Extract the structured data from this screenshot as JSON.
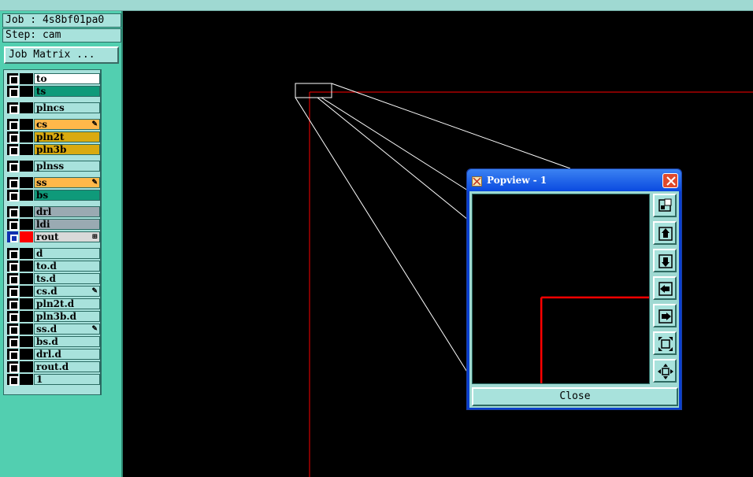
{
  "job": {
    "label": "Job : 4s8bf01pa0",
    "step": "Step: cam"
  },
  "job_matrix_button": "Job Matrix ...",
  "layers": [
    {
      "name": "to",
      "color": "#ffffff",
      "mark": ""
    },
    {
      "name": "ts",
      "color": "#0f9a7a",
      "mark": ""
    },
    {
      "name": "plncs",
      "color": "#a8e2dc",
      "mark": ""
    },
    {
      "name": "cs",
      "color": "#ffb84a",
      "mark": "✎"
    },
    {
      "name": "pln2t",
      "color": "#d9aa10",
      "mark": ""
    },
    {
      "name": "pln3b",
      "color": "#d9aa10",
      "mark": ""
    },
    {
      "name": "plnss",
      "color": "#a8e2dc",
      "mark": ""
    },
    {
      "name": "ss",
      "color": "#ffb84a",
      "mark": "✎"
    },
    {
      "name": "bs",
      "color": "#0f9a7a",
      "mark": ""
    },
    {
      "name": "drl",
      "color": "#9aaab2",
      "mark": ""
    },
    {
      "name": "ldi",
      "color": "#9aaab2",
      "mark": ""
    },
    {
      "name": "rout",
      "color": "#d9d9d9",
      "mark": "⊞"
    },
    {
      "name": "d",
      "color": "#a8e2dc",
      "mark": ""
    },
    {
      "name": "to.d",
      "color": "#a8e2dc",
      "mark": ""
    },
    {
      "name": "ts.d",
      "color": "#a8e2dc",
      "mark": ""
    },
    {
      "name": "cs.d",
      "color": "#a8e2dc",
      "mark": "✎"
    },
    {
      "name": "pln2t.d",
      "color": "#a8e2dc",
      "mark": ""
    },
    {
      "name": "pln3b.d",
      "color": "#a8e2dc",
      "mark": ""
    },
    {
      "name": "ss.d",
      "color": "#a8e2dc",
      "mark": "✎"
    },
    {
      "name": "bs.d",
      "color": "#a8e2dc",
      "mark": ""
    },
    {
      "name": "drl.d",
      "color": "#a8e2dc",
      "mark": ""
    },
    {
      "name": "rout.d",
      "color": "#a8e2dc",
      "mark": ""
    },
    {
      "name": "1",
      "color": "#a8e2dc",
      "mark": ""
    }
  ],
  "popview": {
    "title": "Popview - 1",
    "close_label": "Close",
    "tools": [
      {
        "icon": "zoom-home-icon"
      },
      {
        "icon": "pan-up-icon"
      },
      {
        "icon": "pan-down-icon"
      },
      {
        "icon": "pan-left-icon"
      },
      {
        "icon": "pan-right-icon"
      },
      {
        "icon": "zoom-in-icon"
      },
      {
        "icon": "zoom-out-icon"
      }
    ]
  },
  "colors": {
    "board_outline": "#ff0000",
    "accent_panel": "#52cfb0",
    "title_bar": "#0a4ae0"
  }
}
